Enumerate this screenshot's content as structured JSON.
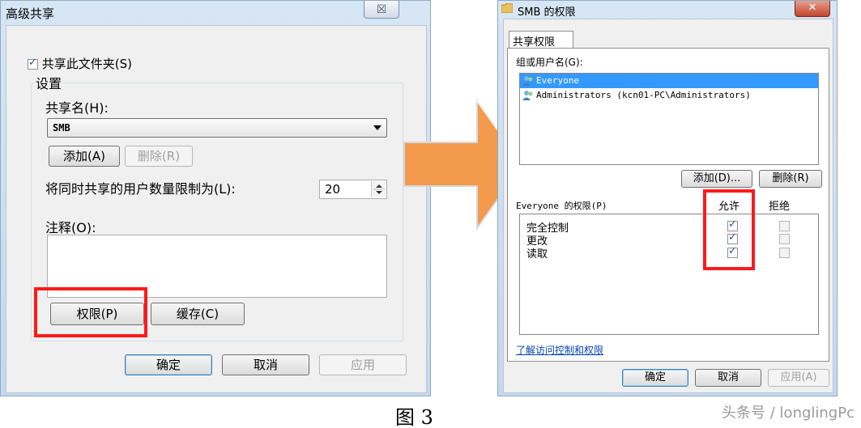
{
  "left_dialog": {
    "title": "高级共享",
    "close_glyph": "☒",
    "share_checkbox_label": "共享此文件夹(S)",
    "settings_legend": "设置",
    "share_name_label": "共享名(H):",
    "share_name_value": "SMB",
    "add_label": "添加(A)",
    "remove_label": "删除(R)",
    "limit_label": "将同时共享的用户数量限制为(L):",
    "limit_value": "20",
    "comment_label": "注释(O):",
    "permissions_label": "权限(P)",
    "cache_label": "缓存(C)",
    "ok_label": "确定",
    "cancel_label": "取消",
    "apply_label": "应用"
  },
  "right_dialog": {
    "title": "SMB 的权限",
    "close_glyph": "✕",
    "tab_label": "共享权限",
    "groups_label": "组或用户名(G):",
    "users": [
      "Everyone",
      "Administrators (kcn01-PC\\Administrators)"
    ],
    "add_label": "添加(D)...",
    "remove_label": "删除(R)",
    "perm_header": "Everyone 的权限(P)",
    "allow_header": "允许",
    "deny_header": "拒绝",
    "permissions": [
      {
        "name": "完全控制",
        "allow": true,
        "deny": false
      },
      {
        "name": "更改",
        "allow": true,
        "deny": false
      },
      {
        "name": "读取",
        "allow": true,
        "deny": false
      }
    ],
    "learn_link": "了解访问控制和权限",
    "ok_label": "确定",
    "cancel_label": "取消",
    "apply_label": "应用(A)"
  },
  "caption": "图 3",
  "watermark": "头条号 / longlingPc",
  "colors": {
    "highlight_red": "#ff1a1a",
    "arrow_orange": "#f39a4c",
    "selection_blue": "#3399ff"
  }
}
